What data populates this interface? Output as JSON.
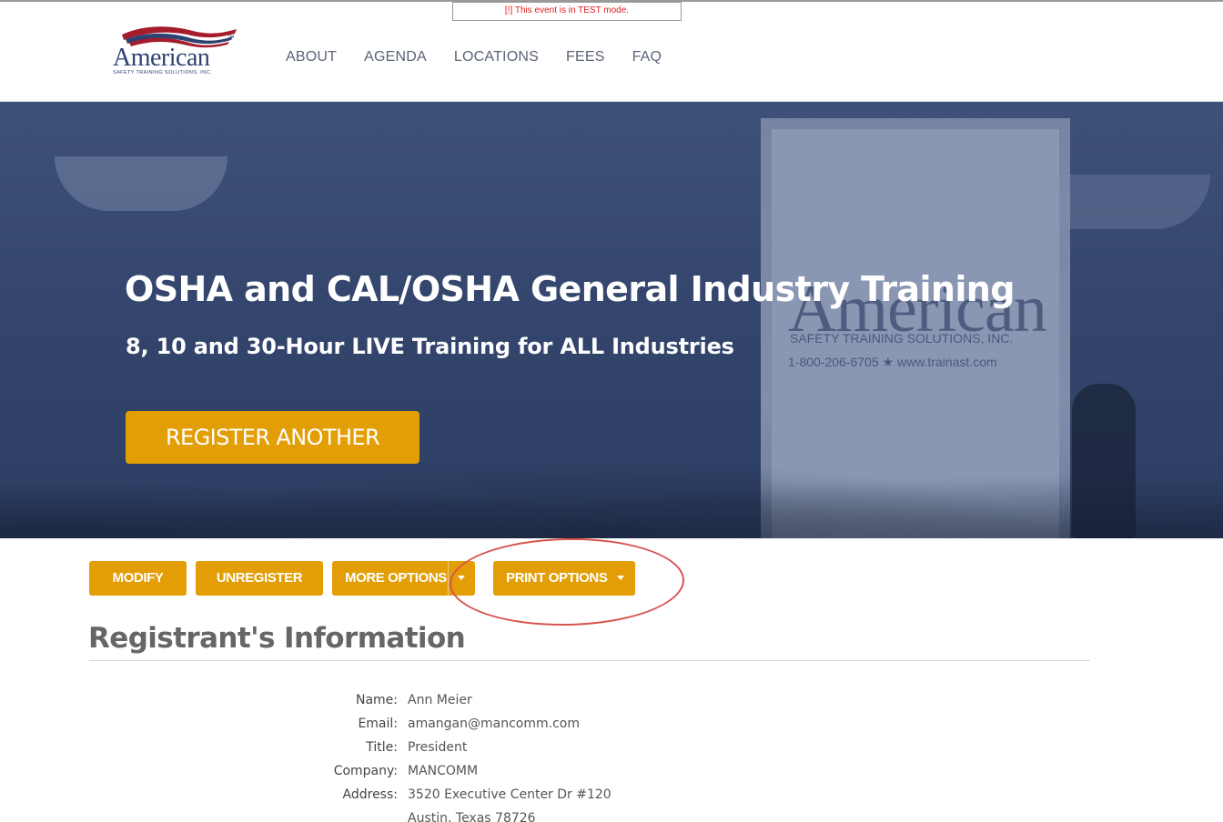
{
  "test_banner": "[!] This event is in TEST mode.",
  "logo": {
    "word": "American",
    "tagline": "SAFETY TRAINING SOLUTIONS, INC.",
    "tm": "TM"
  },
  "nav": {
    "items": [
      "ABOUT",
      "AGENDA",
      "LOCATIONS",
      "FEES",
      "FAQ"
    ]
  },
  "hero": {
    "title": "OSHA and CAL/OSHA General Industry Training",
    "subtitle": "8, 10 and 30-Hour LIVE Training for ALL Industries",
    "button_label": "REGISTER ANOTHER",
    "background_text": {
      "word": "American",
      "company": "SAFETY TRAINING SOLUTIONS, INC.",
      "contact": "1-800-206-6705  ★  www.trainast.com"
    }
  },
  "actions": {
    "modify": "MODIFY",
    "unregister": "UNREGISTER",
    "more_options": "MORE OPTIONS",
    "print_options": "PRINT OPTIONS"
  },
  "section": {
    "title": "Registrant's Information"
  },
  "registrant": [
    {
      "label": "Name:",
      "value": "Ann Meier"
    },
    {
      "label": "Email:",
      "value": "amangan@mancomm.com"
    },
    {
      "label": "Title:",
      "value": "President"
    },
    {
      "label": "Company:",
      "value": "MANCOMM"
    },
    {
      "label": "Address:",
      "value": "3520 Executive Center Dr #120"
    },
    {
      "label": "",
      "value": "Austin, Texas 78726"
    }
  ],
  "colors": {
    "accent": "#e39e06",
    "hero_blue": "#34466d",
    "brand_blue": "#2e4272",
    "highlight_red": "#d9534f"
  }
}
